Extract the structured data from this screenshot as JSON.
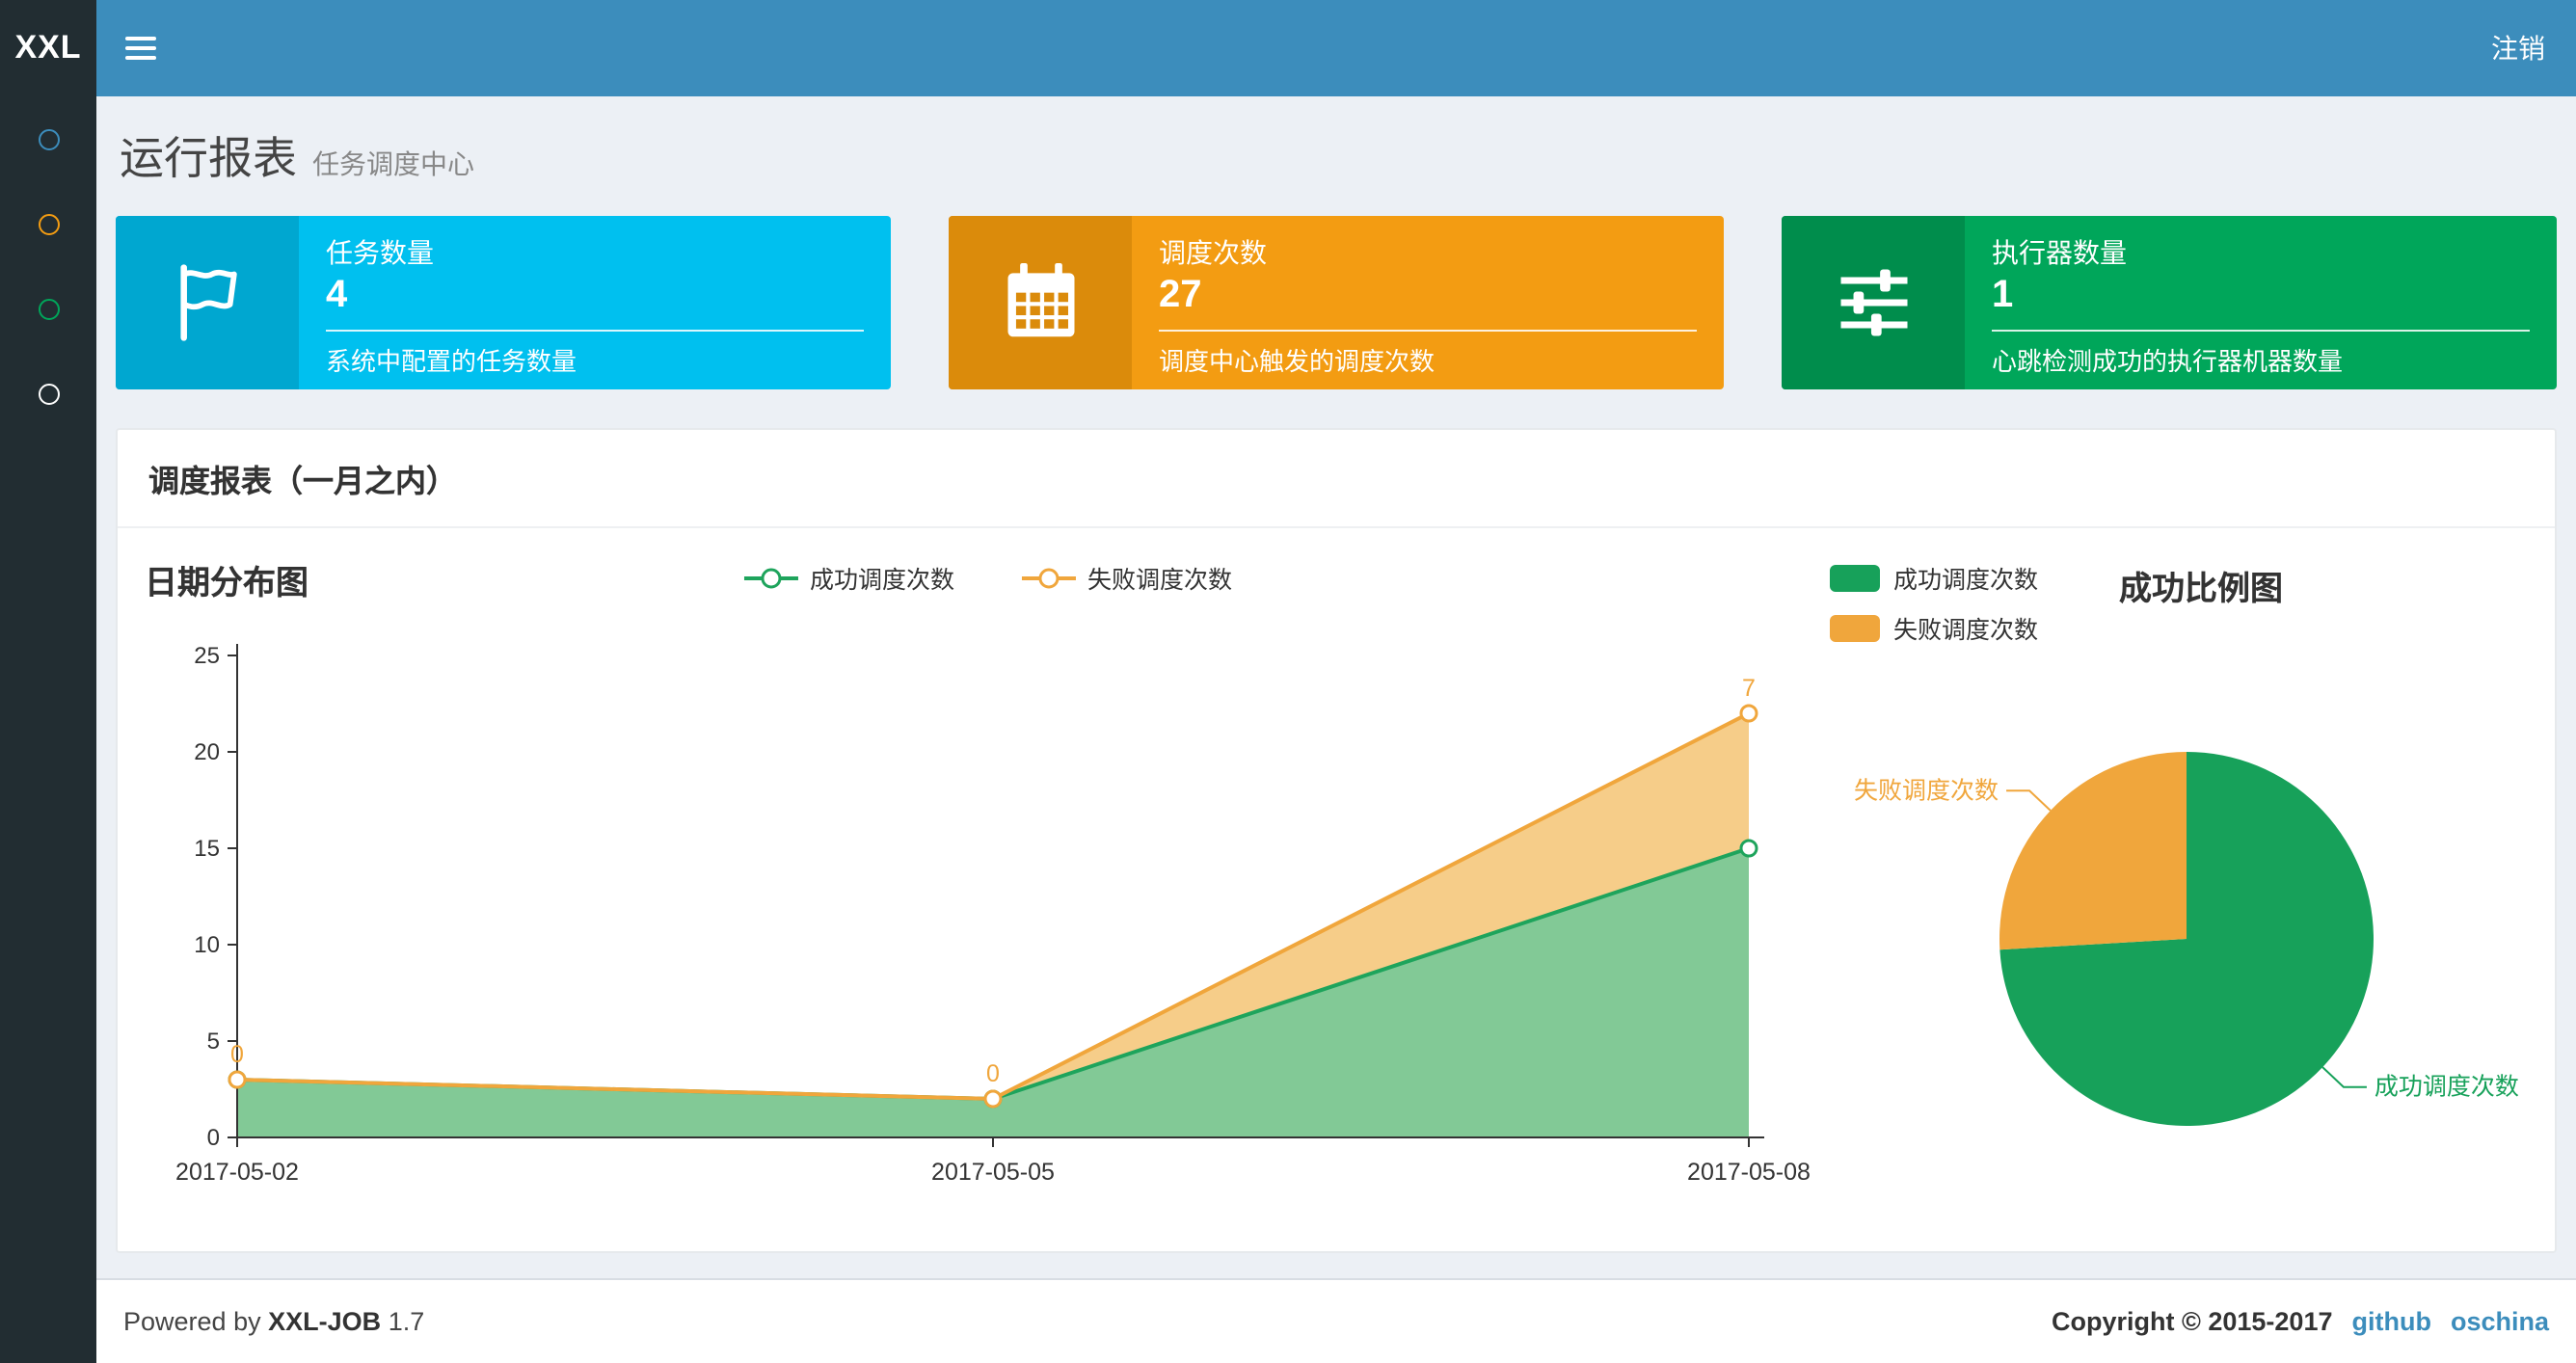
{
  "theme": {
    "navbar_bg": "#3c8dbc",
    "logo_bg": "#222d32",
    "sidebar_bg": "#222d32",
    "content_bg": "#ecf0f5",
    "link_color": "#3c8dbc"
  },
  "navbar": {
    "logo_text": "XXL",
    "logout_label": "注销"
  },
  "sidebar": {
    "items": [
      {
        "name": "dashboard",
        "icon": "circle-icon",
        "color": "#3c8dbc"
      },
      {
        "name": "job-manage",
        "icon": "circle-icon",
        "color": "#f39c12"
      },
      {
        "name": "job-log",
        "icon": "circle-icon",
        "color": "#00a65a"
      },
      {
        "name": "executor-manage",
        "icon": "circle-icon",
        "color": "#ffffff"
      }
    ]
  },
  "page_header": {
    "title": "运行报表",
    "subtitle": "任务调度中心"
  },
  "info_boxes": [
    {
      "title": "任务数量",
      "value": "4",
      "description": "系统中配置的任务数量",
      "icon": "flag-icon",
      "bg_color": "#00c0ef",
      "icon_bg_color": "#00a7d0"
    },
    {
      "title": "调度次数",
      "value": "27",
      "description": "调度中心触发的调度次数",
      "icon": "calendar-icon",
      "bg_color": "#f39c12",
      "icon_bg_color": "#db8b0b"
    },
    {
      "title": "执行器数量",
      "value": "1",
      "description": "心跳检测成功的执行器机器数量",
      "icon": "sliders-icon",
      "bg_color": "#00a65a",
      "icon_bg_color": "#008d4c"
    }
  ],
  "report_panel": {
    "title": "调度报表（一月之内）"
  },
  "chart_data": [
    {
      "type": "area",
      "title": "日期分布图",
      "x": [
        "2017-05-02",
        "2017-05-05",
        "2017-05-08"
      ],
      "stacked": true,
      "series": [
        {
          "name": "成功调度次数",
          "values": [
            3,
            2,
            15
          ],
          "color": "#1ea45c",
          "area_color": "#6cc084",
          "marker": "hollow-circle"
        },
        {
          "name": "失败调度次数",
          "values": [
            0,
            0,
            7
          ],
          "color": "#f0a63c",
          "area_color": "#f4c474",
          "marker": "hollow-circle",
          "show_point_labels": true
        }
      ],
      "ylim": [
        0,
        25
      ],
      "yticks": [
        0,
        5,
        10,
        15,
        20,
        25
      ],
      "legend_position": "top-center",
      "grid": false
    },
    {
      "type": "pie",
      "title": "成功比例图",
      "series": [
        {
          "name": "成功调度次数",
          "value": 20,
          "color": "#17a15a"
        },
        {
          "name": "失败调度次数",
          "value": 7,
          "color": "#f0a63c"
        }
      ],
      "legend_position": "top-left",
      "start_angle": "top",
      "direction": "clockwise"
    }
  ],
  "footer": {
    "powered_by_prefix": "Powered by",
    "product": "XXL-JOB",
    "version": "1.7",
    "copyright": "Copyright © 2015-2017",
    "links": [
      {
        "label": "github"
      },
      {
        "label": "oschina"
      }
    ]
  }
}
